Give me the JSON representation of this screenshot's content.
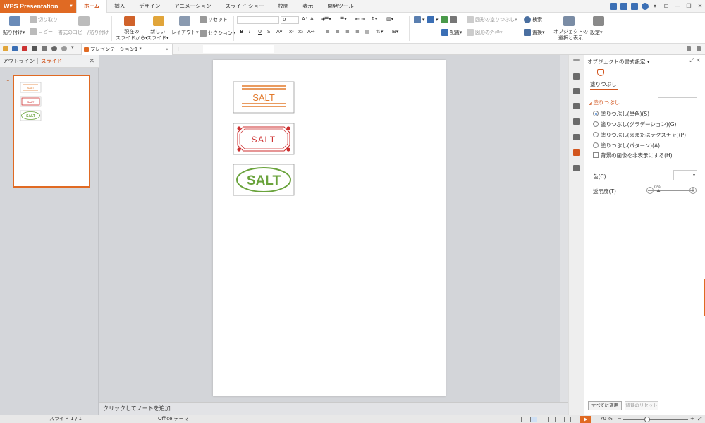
{
  "app": {
    "name": "WPS Presentation"
  },
  "tabs": [
    "ホーム",
    "挿入",
    "デザイン",
    "アニメーション",
    "スライド ショー",
    "校閲",
    "表示",
    "開発ツール"
  ],
  "active_tab": "ホーム",
  "ribbon": {
    "paste": "貼り付け",
    "cut": "切り取り",
    "copy": "コピー",
    "format_painter": "書式のコピー/貼り付け",
    "from_current": "現在の",
    "from_current_2": "スライドから",
    "new_slide": "新しい",
    "new_slide_2": "スライド",
    "layout": "レイアウト",
    "reset": "リセット",
    "section": "セクション",
    "font_size": "0",
    "shape_fill": "図形の塗りつぶし",
    "shape_outline": "図形の外枠",
    "arrange": "配置",
    "find": "検索",
    "replace": "置換",
    "select_pane": "オブジェクトの",
    "select_pane_2": "選択と表示",
    "settings": "設定"
  },
  "doc": {
    "tab_label": "プレゼンテーション1 *"
  },
  "left_panel": {
    "outline": "アウトライン",
    "slides": "スライド",
    "slide_number": "1"
  },
  "slide": {
    "labels": [
      "SALT",
      "SALT",
      "SALT"
    ],
    "colors": {
      "orange": "#e27a2c",
      "red": "#cc2e2e",
      "green": "#6aa33c"
    }
  },
  "notes": {
    "placeholder": "クリックしてノートを追加"
  },
  "right_pane": {
    "title": "オブジェクトの書式設定",
    "tab": "塗りつぶし",
    "section": "塗りつぶし",
    "options": [
      "塗りつぶし(単色)(S)",
      "塗りつぶし(グラデーション)(G)",
      "塗りつぶし(図またはテクスチャ)(P)",
      "塗りつぶし(パターン)(A)"
    ],
    "hide_bg": "背景の画像を非表示にする(H)",
    "color_label": "色(C)",
    "transparency_label": "透明度(T)",
    "transparency_value": "0%",
    "apply_all": "すべてに適用",
    "reset_bg": "背景のリセット"
  },
  "status": {
    "slide_info": "スライド 1 / 1",
    "theme": "Office テーマ",
    "zoom": "70 %"
  }
}
